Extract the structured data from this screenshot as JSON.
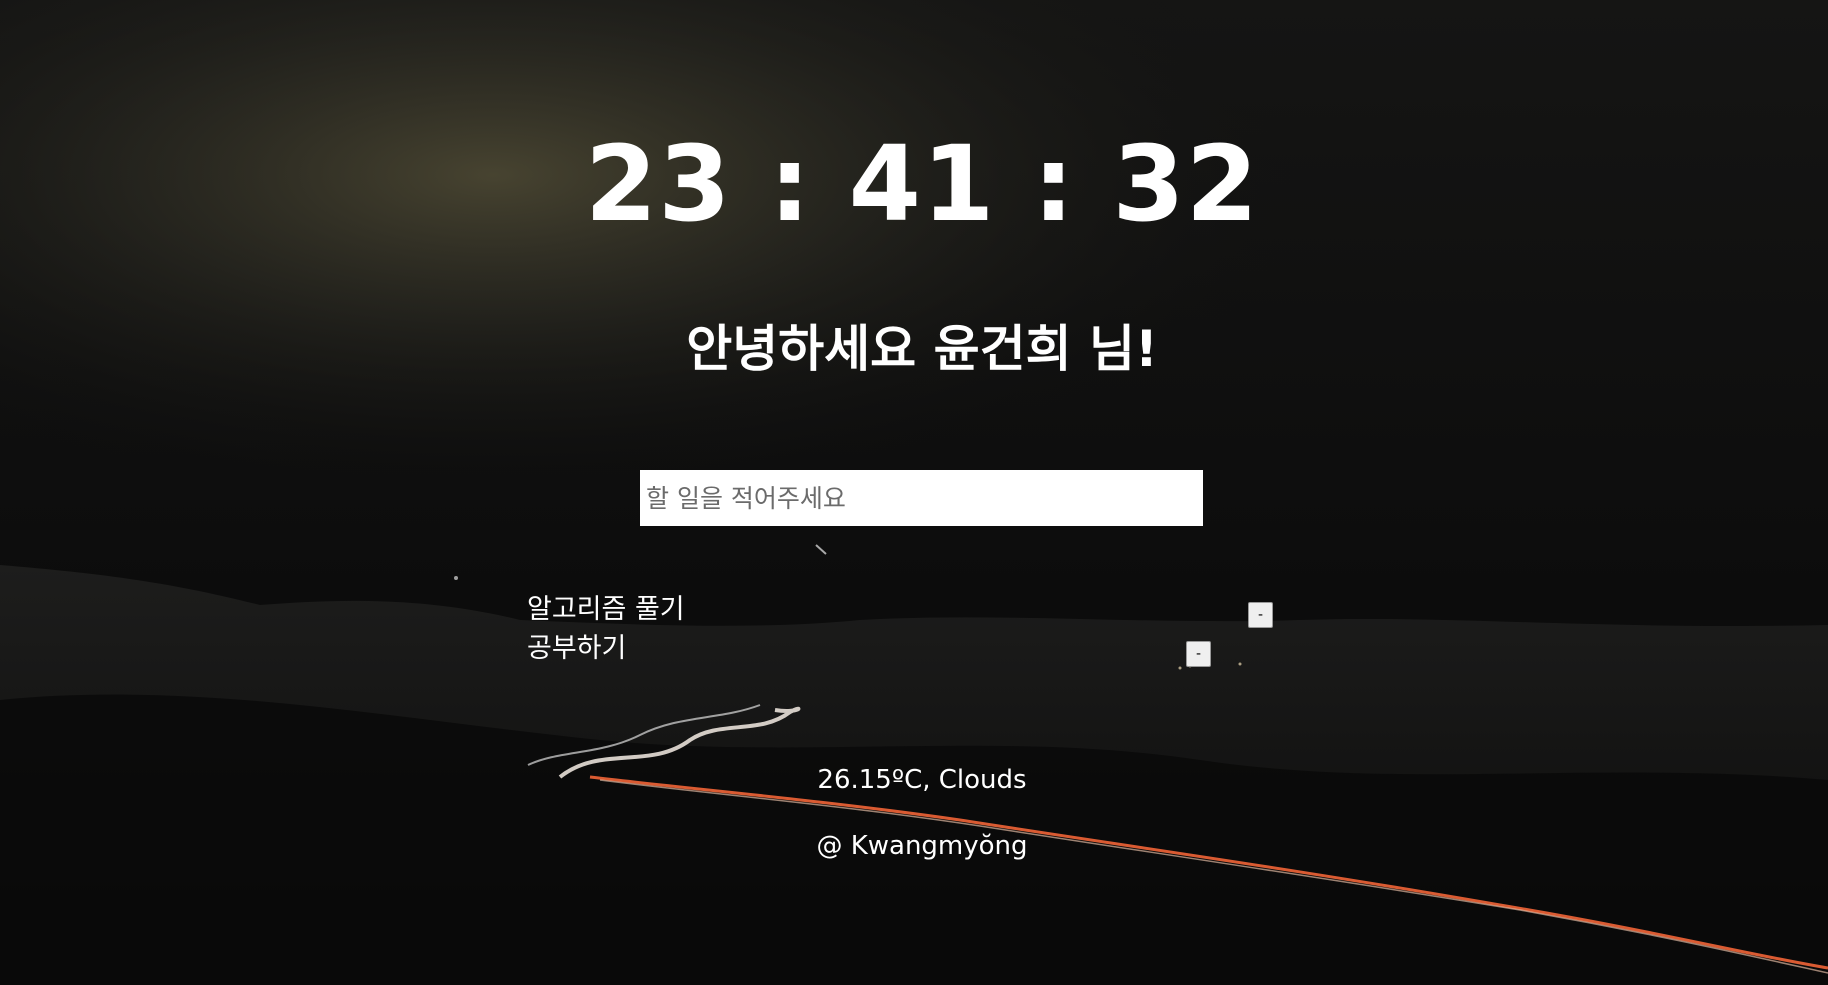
{
  "clock": {
    "time": "23 : 41 : 32"
  },
  "greeting": {
    "text": "안녕하세요 윤건희 님!"
  },
  "todo": {
    "placeholder": "할 일을 적어주세요",
    "items": [
      {
        "text": "알고리즘 풀기",
        "delete_label": "-"
      },
      {
        "text": "공부하기",
        "delete_label": "-"
      }
    ]
  },
  "weather": {
    "summary": "26.15ºC, Clouds",
    "location": "@ Kwangmyŏng"
  },
  "background": {
    "description_icon": "night-landscape-image",
    "sky_glow_color": "#4a4632",
    "trail_color": "#ff6a3a"
  }
}
